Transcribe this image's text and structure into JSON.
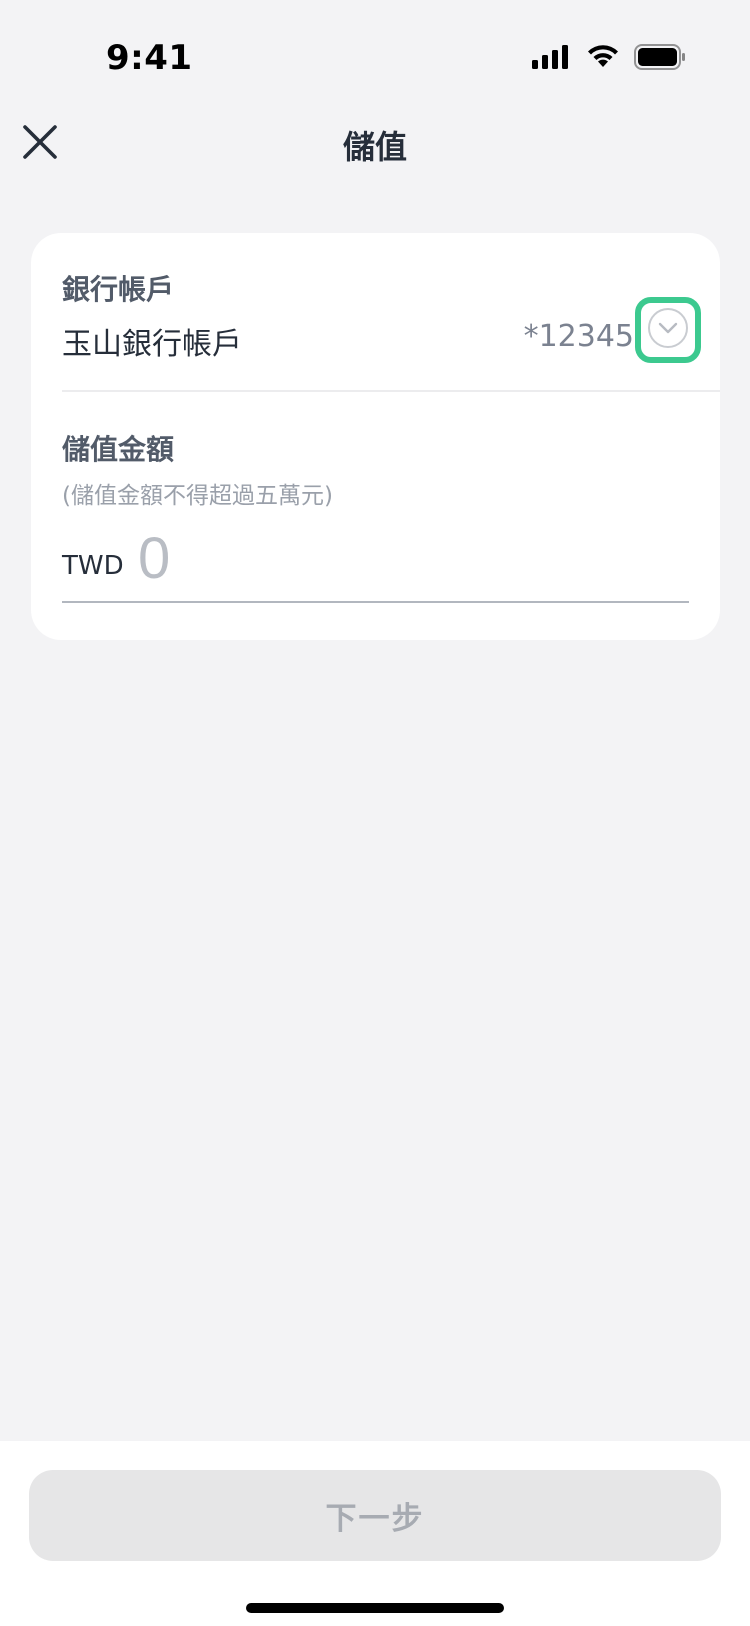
{
  "status_bar": {
    "time": "9:41",
    "icons": [
      "cellular-signal-icon",
      "wifi-icon",
      "battery-icon"
    ]
  },
  "header": {
    "title": "儲值",
    "close_icon": "close-icon"
  },
  "bank_account": {
    "label": "銀行帳戶",
    "name": "玉山銀行帳戶",
    "number": "*12345",
    "dropdown_icon": "chevron-down-circle-icon"
  },
  "amount": {
    "label": "儲值金額",
    "hint": "(儲值金額不得超過五萬元)",
    "currency": "TWD",
    "placeholder": "0",
    "value": ""
  },
  "footer": {
    "next_label": "下一步"
  },
  "colors": {
    "accent": "#3cc98f",
    "background": "#f3f3f5",
    "card": "#ffffff",
    "button_disabled": "#e6e6e7",
    "button_text_disabled": "#a7abb2"
  }
}
